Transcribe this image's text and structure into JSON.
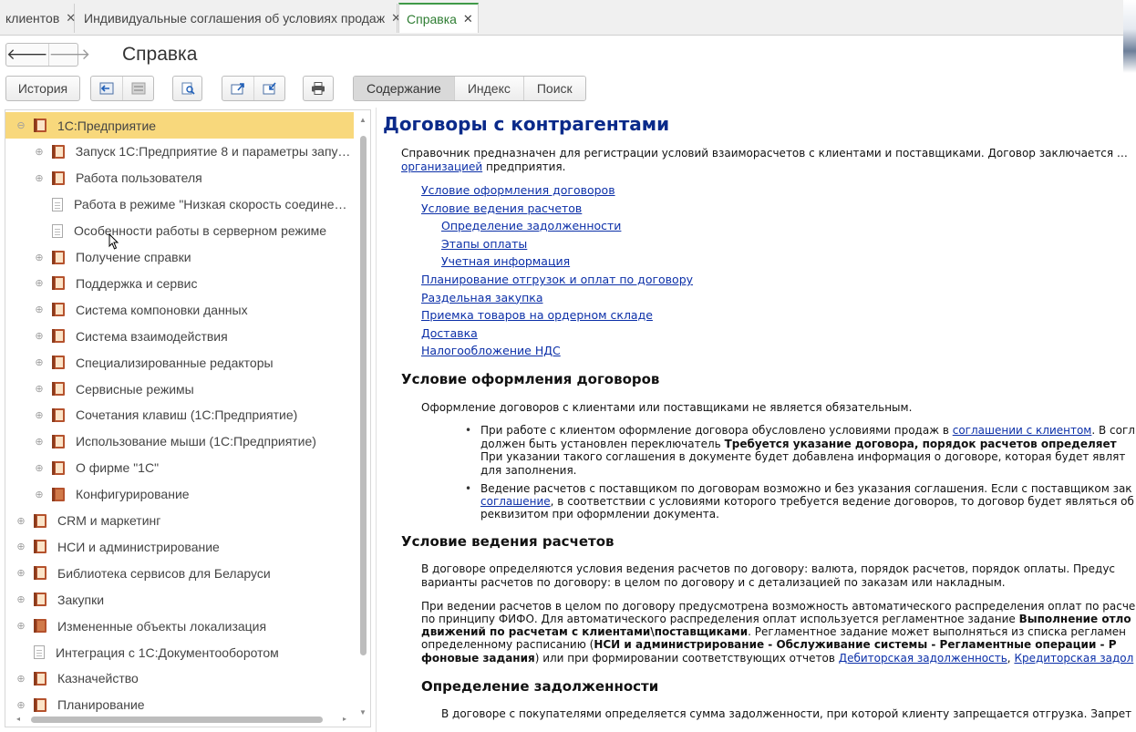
{
  "tabs": [
    {
      "label": "клиентов",
      "active": false
    },
    {
      "label": "Индивидуальные соглашения об условиях продаж",
      "active": false
    },
    {
      "label": "Справка",
      "active": true
    }
  ],
  "tab_close_glyph": "✕",
  "header": {
    "back_icon": "arrow-left-icon",
    "forward_icon": "arrow-right-icon",
    "title": "Справка"
  },
  "toolbar": {
    "history_label": "История",
    "icons": [
      "sync-left-icon",
      "sync-right-icon",
      "search-document-icon",
      "export-icon",
      "import-icon",
      "print-icon"
    ],
    "segments": [
      {
        "label": "Содержание",
        "active": true
      },
      {
        "label": "Индекс",
        "active": false
      },
      {
        "label": "Поиск",
        "active": false
      }
    ]
  },
  "tree": {
    "items": [
      {
        "label": "1С:Предприятие",
        "level": 0,
        "expander": "⊖",
        "icon": "book-icon",
        "selected": true
      },
      {
        "label": "Запуск 1С:Предприятие 8 и параметры запуска",
        "level": 1,
        "expander": "⊕",
        "icon": "book-icon"
      },
      {
        "label": "Работа пользователя",
        "level": 1,
        "expander": "⊕",
        "icon": "book-icon"
      },
      {
        "label": "Работа в режиме \"Низкая скорость соединен…",
        "level": 1,
        "expander": "",
        "icon": "page-icon"
      },
      {
        "label": "Особенности работы в серверном режиме",
        "level": 1,
        "expander": "",
        "icon": "page-icon"
      },
      {
        "label": "Получение справки",
        "level": 1,
        "expander": "⊕",
        "icon": "book-icon"
      },
      {
        "label": "Поддержка и сервис",
        "level": 1,
        "expander": "⊕",
        "icon": "book-icon"
      },
      {
        "label": "Система компоновки данных",
        "level": 1,
        "expander": "⊕",
        "icon": "book-icon"
      },
      {
        "label": "Система взаимодействия",
        "level": 1,
        "expander": "⊕",
        "icon": "book-icon"
      },
      {
        "label": "Специализированные редакторы",
        "level": 1,
        "expander": "⊕",
        "icon": "book-icon"
      },
      {
        "label": "Сервисные режимы",
        "level": 1,
        "expander": "⊕",
        "icon": "book-icon"
      },
      {
        "label": "Сочетания клавиш (1С:Предприятие)",
        "level": 1,
        "expander": "⊕",
        "icon": "book-icon"
      },
      {
        "label": "Использование мыши (1С:Предприятие)",
        "level": 1,
        "expander": "⊕",
        "icon": "book-icon"
      },
      {
        "label": "О фирме \"1С\"",
        "level": 1,
        "expander": "⊕",
        "icon": "book-icon"
      },
      {
        "label": "Конфигурирование",
        "level": 1,
        "expander": "⊕",
        "icon": "closed-book-icon"
      },
      {
        "label": "CRM и маркетинг",
        "level": 0,
        "expander": "⊕",
        "icon": "book-icon"
      },
      {
        "label": "НСИ и администрирование",
        "level": 0,
        "expander": "⊕",
        "icon": "book-icon"
      },
      {
        "label": "Библиотека сервисов для Беларуси",
        "level": 0,
        "expander": "⊕",
        "icon": "book-icon"
      },
      {
        "label": "Закупки",
        "level": 0,
        "expander": "⊕",
        "icon": "book-icon"
      },
      {
        "label": "Измененные объекты локализация",
        "level": 0,
        "expander": "⊕",
        "icon": "closed-book-icon"
      },
      {
        "label": "Интеграция с 1С:Документооборотом",
        "level": 0,
        "expander": "",
        "icon": "page-icon"
      },
      {
        "label": "Казначейство",
        "level": 0,
        "expander": "⊕",
        "icon": "book-icon"
      },
      {
        "label": "Планирование",
        "level": 0,
        "expander": "⊕",
        "icon": "book-icon"
      }
    ]
  },
  "article": {
    "title": "Договоры с контрагентами",
    "intro_line1": "Справочник предназначен для регистрации условий взаиморасчетов с клиентами и поставщиками. Договор заключается …",
    "intro_link": "организацией",
    "intro_line2_rest": " предприятия.",
    "toc": [
      {
        "label": "Условие оформления договоров",
        "level": 0
      },
      {
        "label": "Условие ведения расчетов",
        "level": 0
      },
      {
        "label": "Определение задолженности",
        "level": 1
      },
      {
        "label": "Этапы оплаты",
        "level": 1
      },
      {
        "label": "Учетная информация",
        "level": 1
      },
      {
        "label": "Планирование отгрузок и оплат по договору",
        "level": 0
      },
      {
        "label": "Раздельная закупка",
        "level": 0
      },
      {
        "label": "Приемка товаров на ордерном складе",
        "level": 0
      },
      {
        "label": "Доставка",
        "level": 0
      },
      {
        "label": "Налогообложение НДС",
        "level": 0
      }
    ],
    "s1": {
      "heading": "Условие оформления договоров",
      "para": "Оформление договоров с клиентами или поставщиками не является обязательным.",
      "b1_l1_pre": "При работе с клиентом оформление договора обусловлено условиями продаж в ",
      "b1_l1_link": "соглашении с клиентом",
      "b1_l1_post": ". В согл",
      "b1_l2_pre": "должен быть установлен переключатель ",
      "b1_l2_bold": "Требуется указание договора, порядок расчетов определяет",
      "b1_l3": "При указании такого соглашения в документе будет добавлена информация о договоре, которая будет являт",
      "b1_l4": "для заполнения.",
      "b2_l1": "Ведение расчетов с поставщиком по договорам возможно и без указания соглашения. Если с поставщиком зак",
      "b2_l2_link": "соглашение",
      "b2_l2_post": ", в соответствии с условиями которого требуется ведение договоров, то договор будет являться об",
      "b2_l3": "реквизитом при оформлении документа."
    },
    "s2": {
      "heading": "Условие ведения расчетов",
      "p1_l1": "В договоре определяются условия ведения расчетов по договору: валюта, порядок расчетов, порядок оплаты. Предус",
      "p1_l2": "варианты расчетов по договору: в целом по договору и с детализацией по заказам или накладным.",
      "p2_l1": "При ведении расчетов в целом по договору предусмотрена возможность автоматического распределения оплат по расче",
      "p2_l2_pre": "по принципу ФИФО. Для автоматического распределения оплат используется регламентное задание ",
      "p2_l2_bold": "Выполнение отло",
      "p2_l3_bold": "движений по расчетам с клиентами\\поставщиками",
      "p2_l3_post": ". Регламентное задание может выполняться из списка регламен",
      "p2_l4_pre": "определенному расписанию (",
      "p2_l4_bold": "НСИ и администрирование - Обслуживание системы - Регламентные операции - Р",
      "p2_l5_bold": "фоновые задания",
      "p2_l5_mid": ") или при формировании соответствующих отчетов ",
      "p2_l5_link1": "Дебиторская задолженность",
      "p2_l5_sep": ", ",
      "p2_l5_link2": "Кредиторская задол"
    },
    "s3": {
      "heading": "Определение задолженности",
      "p1": "В договоре с покупателями определяется сумма задолженности, при которой клиенту запрещается отгрузка. Запрет"
    }
  },
  "colors": {
    "active_tab": "#3f9a48",
    "selected_tree_row": "#f8d87c",
    "link": "#0b2fa8",
    "article_title": "#0a2a8a",
    "book_icon": "#b5522d"
  }
}
